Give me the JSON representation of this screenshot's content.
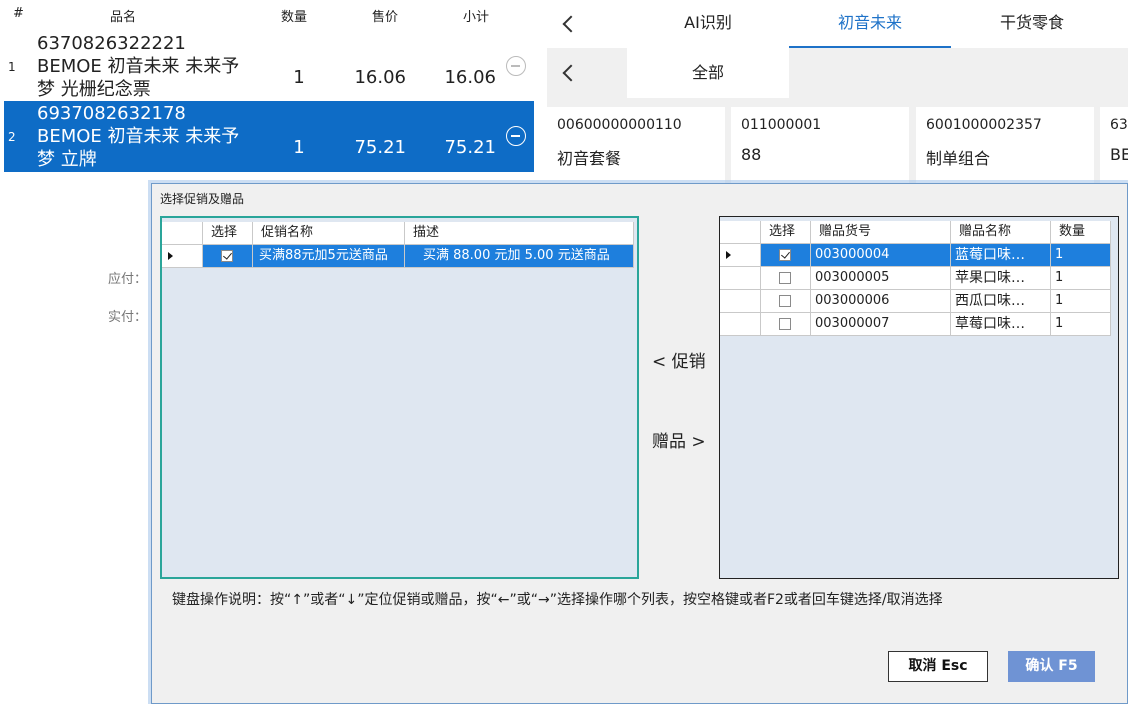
{
  "cart": {
    "headers": {
      "index": "#",
      "name": "品名",
      "qty": "数量",
      "price": "售价",
      "subtotal": "小计"
    },
    "rows": [
      {
        "index": "1",
        "name": "6370826322221 BEMOE 初音未来 未来予梦 光栅纪念票",
        "qty": "1",
        "price": "16.06",
        "subtotal": "16.06",
        "selected": false
      },
      {
        "index": "2",
        "name": "6937082632178 BEMOE 初音未来 未来予梦 立牌",
        "qty": "1",
        "price": "75.21",
        "subtotal": "75.21",
        "selected": true
      }
    ],
    "payable_label": "应付：",
    "paid_label": "实付："
  },
  "catalog": {
    "tabs": [
      {
        "label": "AI识别",
        "active": false
      },
      {
        "label": "初音未来",
        "active": true
      },
      {
        "label": "干货零食",
        "active": false
      }
    ],
    "subtab": "全部",
    "cards": [
      {
        "code": "00600000000110",
        "name": "初音套餐"
      },
      {
        "code": "011000001",
        "name": "88"
      },
      {
        "code": "6001000002357",
        "name": "制单组合"
      },
      {
        "code": "63",
        "name": "BE"
      }
    ]
  },
  "dialog": {
    "title": "选择促销及赠品",
    "promo_grid": {
      "headers": [
        "选择",
        "促销名称",
        "描述"
      ],
      "rows": [
        {
          "checked": true,
          "name": "买满88元加5元送商品",
          "desc": "买满 88.00 元加 5.00 元送商品"
        }
      ]
    },
    "promo_link": "< 促销",
    "gift_link": "赠品 >",
    "gift_grid": {
      "headers": [
        "选择",
        "赠品货号",
        "赠品名称",
        "数量"
      ],
      "rows": [
        {
          "checked": true,
          "code": "003000004",
          "name": "蓝莓口味…",
          "qty": "1"
        },
        {
          "checked": false,
          "code": "003000005",
          "name": "苹果口味…",
          "qty": "1"
        },
        {
          "checked": false,
          "code": "003000006",
          "name": "西瓜口味…",
          "qty": "1"
        },
        {
          "checked": false,
          "code": "003000007",
          "name": "草莓口味…",
          "qty": "1"
        }
      ]
    },
    "help_text": "键盘操作说明：按“↑”或者“↓”定位促销或赠品，按“←”或“→”选择操作哪个列表，按空格键或者F2或者回车键选择/取消选择",
    "cancel_label": "取消 Esc",
    "confirm_label": "确认 F5"
  },
  "colors": {
    "selection_blue": "#0e6cc6",
    "accent_blue": "#1e72c8",
    "grid_highlight": "#1e7fdd",
    "confirm_button": "#6f93d4",
    "promo_border": "#2aa59a"
  }
}
